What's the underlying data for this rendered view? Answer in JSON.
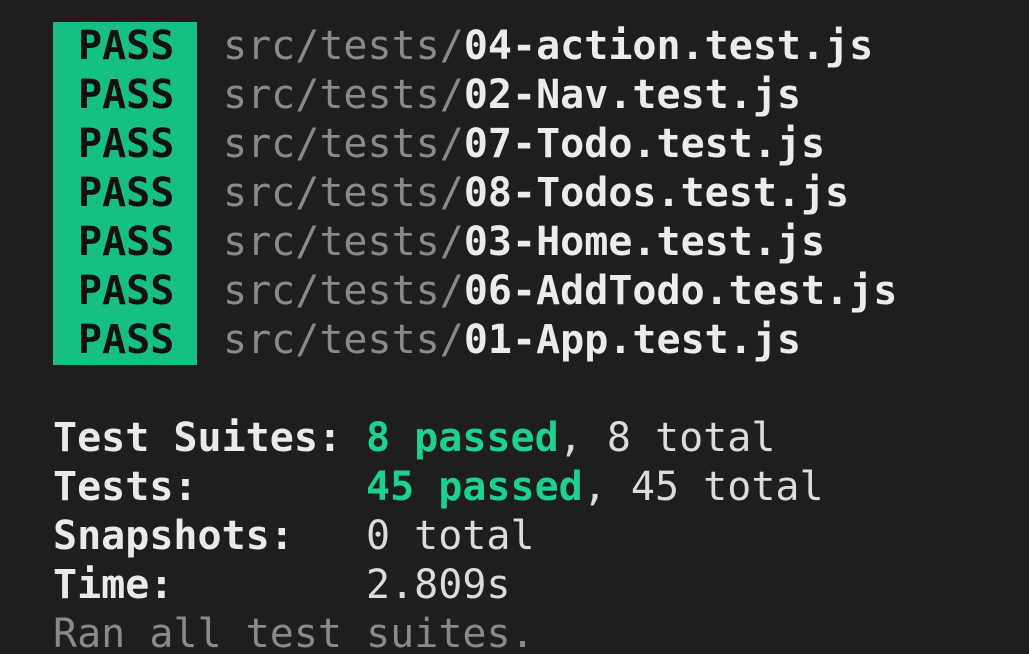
{
  "results": [
    {
      "status": "PASS",
      "dir": "src/tests/",
      "file": "04-action.test.js"
    },
    {
      "status": "PASS",
      "dir": "src/tests/",
      "file": "02-Nav.test.js"
    },
    {
      "status": "PASS",
      "dir": "src/tests/",
      "file": "07-Todo.test.js"
    },
    {
      "status": "PASS",
      "dir": "src/tests/",
      "file": "08-Todos.test.js"
    },
    {
      "status": "PASS",
      "dir": "src/tests/",
      "file": "03-Home.test.js"
    },
    {
      "status": "PASS",
      "dir": "src/tests/",
      "file": "06-AddTodo.test.js"
    },
    {
      "status": "PASS",
      "dir": "src/tests/",
      "file": "01-App.test.js"
    }
  ],
  "summary": {
    "suites": {
      "label": "Test Suites:",
      "passed": "8 passed",
      "rest": ", 8 total"
    },
    "tests": {
      "label": "Tests:",
      "passed": "45 passed",
      "rest": ", 45 total"
    },
    "snapshots": {
      "label": "Snapshots:",
      "value": "0 total"
    },
    "time": {
      "label": "Time:",
      "value": "2.809s"
    },
    "footer": "Ran all test suites."
  },
  "colors": {
    "background": "#1e1e1e",
    "pass_badge": "#16c083",
    "passed_text": "#1fd18f",
    "dim_text": "#8a8a8a"
  }
}
